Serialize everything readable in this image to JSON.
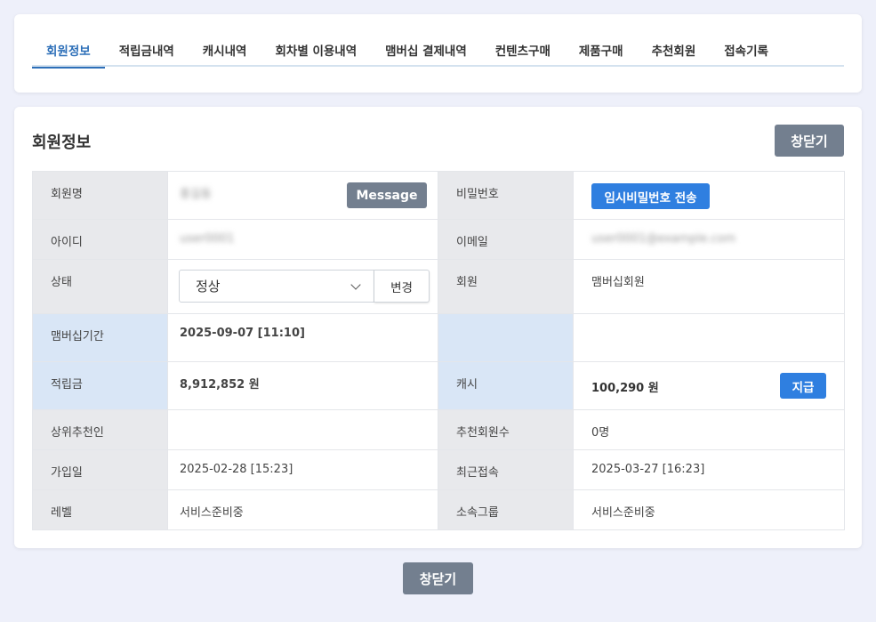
{
  "tabs": [
    {
      "label": "회원정보",
      "active": true
    },
    {
      "label": "적립금내역"
    },
    {
      "label": "캐시내역"
    },
    {
      "label": "회차별 이용내역"
    },
    {
      "label": "맴버십 결제내역"
    },
    {
      "label": "컨텐츠구매"
    },
    {
      "label": "제품구매"
    },
    {
      "label": "추천회원"
    },
    {
      "label": "접속기록"
    }
  ],
  "panel": {
    "title": "회원정보",
    "close_label": "창닫기"
  },
  "info": {
    "name_label": "회원명",
    "name_value": "홍길동",
    "message_label": "Message",
    "password_label": "비밀번호",
    "temp_password_label": "임시비밀번호 전송",
    "id_label": "아이디",
    "id_value": "user0001",
    "email_label": "이메일",
    "email_value": "user0001@example.com",
    "status_label": "상태",
    "status_value": "정상",
    "status_change_label": "변경",
    "member_label": "회원",
    "member_value": "맴버십회원",
    "membership_period_label": "맴버십기간",
    "membership_period_value": "2025-09-07 [11:10]",
    "points_label": "적립금",
    "points_value": "8,912,852 원",
    "cash_label": "캐시",
    "cash_value": "100,290 원",
    "pay_label": "지급",
    "referrer_label": "상위추천인",
    "referrer_value": "",
    "referral_count_label": "추천회원수",
    "referral_count_value": "0명",
    "joined_label": "가입일",
    "joined_value": "2025-02-28 [15:23]",
    "last_login_label": "최근접속",
    "last_login_value": "2025-03-27 [16:23]",
    "level_label": "레벨",
    "level_value": "서비스준비중",
    "group_label": "소속그룹",
    "group_value": "서비스준비중"
  },
  "footer": {
    "close_label": "창닫기"
  },
  "colors": {
    "accent": "#2d6fb8",
    "primary_button": "#2f7fe0",
    "gray_button": "#737f8f",
    "label_bg": "#e8e9ec",
    "highlight_bg": "#d9e6f6"
  }
}
